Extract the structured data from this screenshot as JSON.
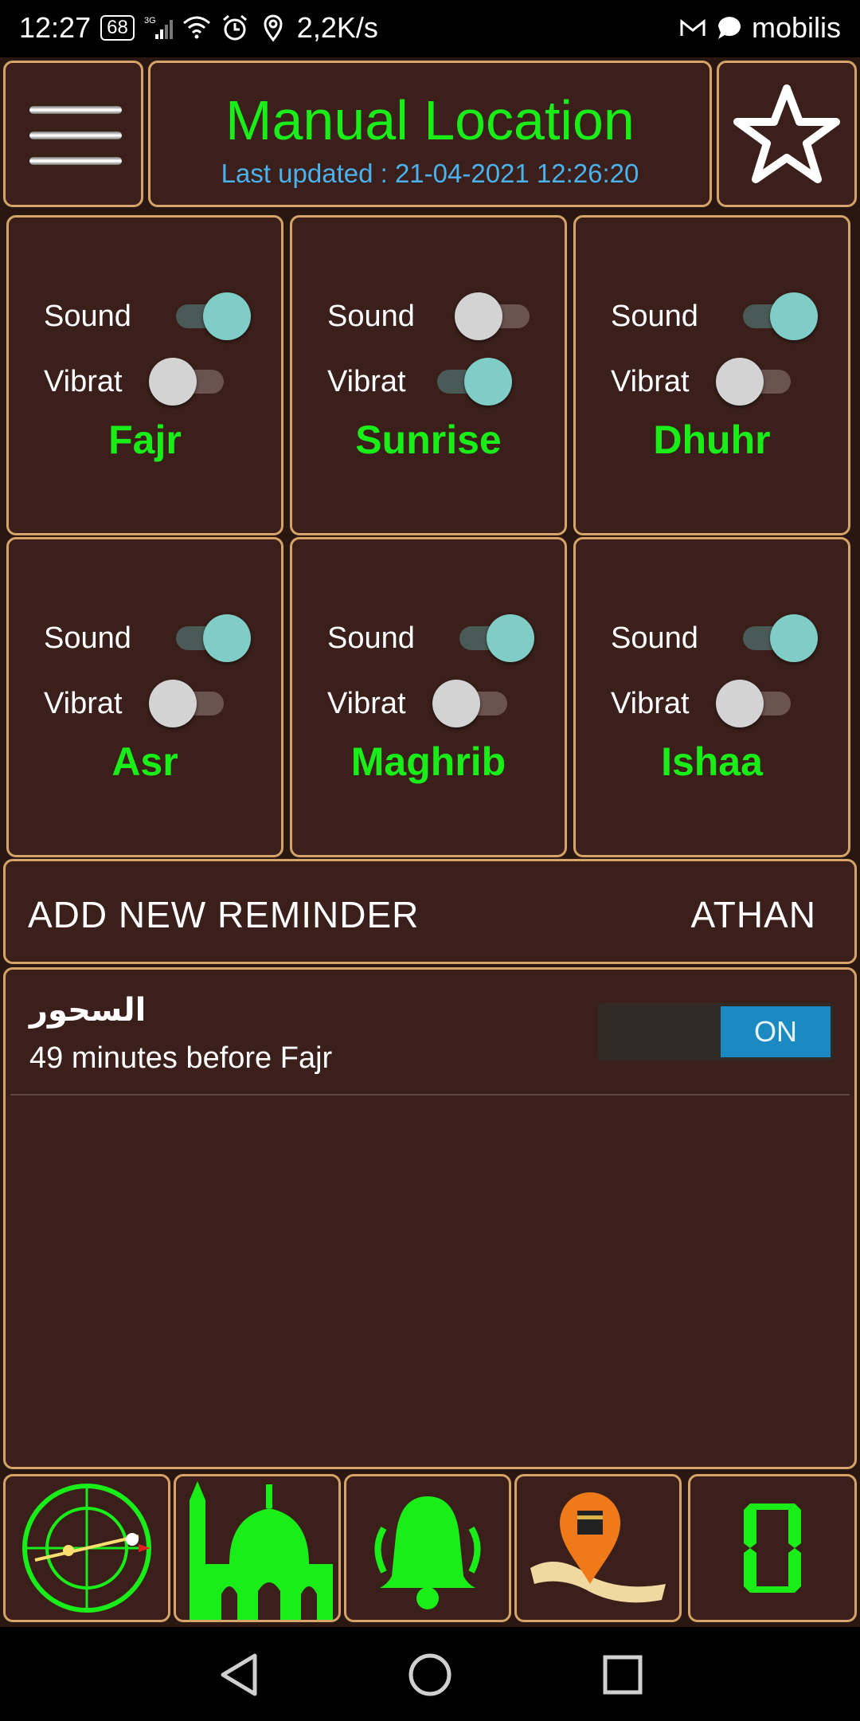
{
  "status_bar": {
    "time": "12:27",
    "battery": "68",
    "network": "3G",
    "speed": "2,2K/s",
    "carrier": "mobilis"
  },
  "header": {
    "title": "Manual Location",
    "subtitle": "Last updated : 21-04-2021 12:26:20"
  },
  "colors": {
    "accent_green": "#19ee19",
    "subtitle_blue": "#4ab3ee",
    "panel_bg": "#3a1f1a",
    "border": "#d6a468",
    "switch_on": "#1b8ac2"
  },
  "prayers": [
    {
      "name": "Fajr",
      "sound_label": "Sound",
      "vibrate_label": "Vibrat",
      "sound": true,
      "vibrate": false
    },
    {
      "name": "Sunrise",
      "sound_label": "Sound",
      "vibrate_label": "Vibrat",
      "sound": false,
      "vibrate": true
    },
    {
      "name": "Dhuhr",
      "sound_label": "Sound",
      "vibrate_label": "Vibrat",
      "sound": true,
      "vibrate": false
    },
    {
      "name": "Asr",
      "sound_label": "Sound",
      "vibrate_label": "Vibrat",
      "sound": true,
      "vibrate": false
    },
    {
      "name": "Maghrib",
      "sound_label": "Sound",
      "vibrate_label": "Vibrat",
      "sound": true,
      "vibrate": false
    },
    {
      "name": "Ishaa",
      "sound_label": "Sound",
      "vibrate_label": "Vibrat",
      "sound": true,
      "vibrate": false
    }
  ],
  "reminder_bar": {
    "add_label": "ADD NEW REMINDER",
    "athan_label": "ATHAN"
  },
  "reminders": [
    {
      "title": "السحور",
      "description": "49 minutes before Fajr",
      "state_label": "ON"
    }
  ],
  "toolbar": {
    "icons": [
      "compass-icon",
      "mosque-icon",
      "bell-icon",
      "kaaba-location-icon",
      "digit-counter-icon"
    ],
    "counter_value": "0"
  },
  "nav": {
    "icons": [
      "back-icon",
      "home-icon",
      "recents-icon"
    ]
  }
}
